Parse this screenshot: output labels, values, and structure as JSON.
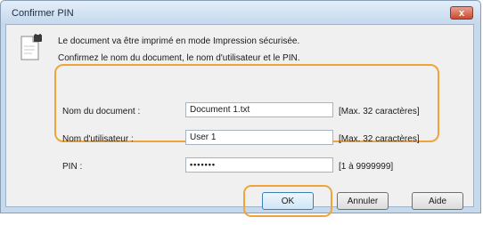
{
  "window": {
    "title": "Confirmer PIN",
    "close_glyph": "x"
  },
  "message": {
    "line1": "Le document va être imprimé en mode Impression sécurisée.",
    "line2": "Confirmez le nom du document, le nom d'utilisateur et le PIN."
  },
  "form": {
    "document_name": {
      "label": "Nom du document :",
      "value": "Document 1.txt",
      "hint": "[Max. 32 caractères]"
    },
    "user_name": {
      "label": "Nom d'utilisateur :",
      "value": "User 1",
      "hint": "[Max. 32 caractères]"
    },
    "pin": {
      "label": "PIN :",
      "value": "•••••••",
      "hint": "[1 à 9999999]"
    }
  },
  "buttons": {
    "ok": "OK",
    "cancel": "Annuler",
    "help": "Aide"
  },
  "colors": {
    "highlight": "#f0a53a",
    "close_button": "#c94a2f"
  },
  "icons": {
    "message_icon": "document-lock-icon",
    "close": "close-icon"
  }
}
